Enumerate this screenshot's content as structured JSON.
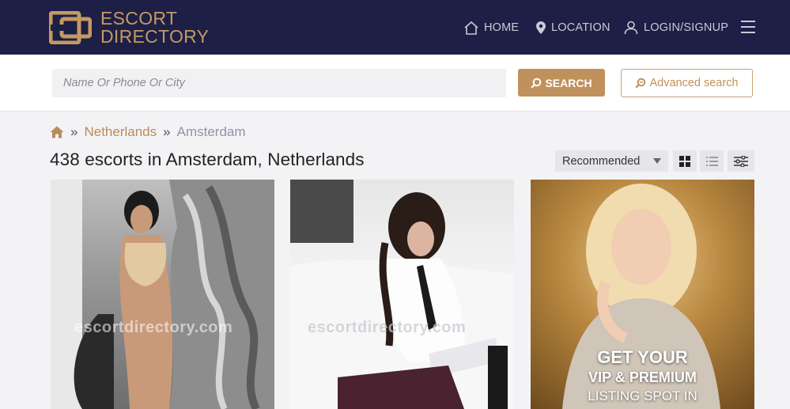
{
  "brand": {
    "line1": "ESCORT",
    "line2": "DIRECTORY",
    "color": "#c49a62"
  },
  "nav": {
    "home": "HOME",
    "location": "LOCATION",
    "login": "LOGIN/SIGNUP",
    "menu_icon": "hamburger-icon"
  },
  "search": {
    "placeholder": "Name Or Phone Or City",
    "value": "",
    "button": "SEARCH",
    "advanced": "Advanced search"
  },
  "breadcrumb": {
    "home_icon": "home-icon",
    "sep1": "»",
    "country": "Netherlands",
    "sep2": "»",
    "city": "Amsterdam"
  },
  "listing": {
    "title": "438 escorts in Amsterdam, Netherlands",
    "sort": "Recommended"
  },
  "cards": [
    {
      "watermark": "escortdirectory.com"
    },
    {
      "watermark": "escortdirectory.com"
    },
    {
      "promo_line1": "GET YOUR",
      "promo_line2": "VIP & PREMIUM",
      "promo_line3": "LISTING SPOT IN"
    }
  ],
  "colors": {
    "header_bg": "#1e1f46",
    "accent": "#c0915c",
    "page_bg": "#f3f3f5"
  }
}
